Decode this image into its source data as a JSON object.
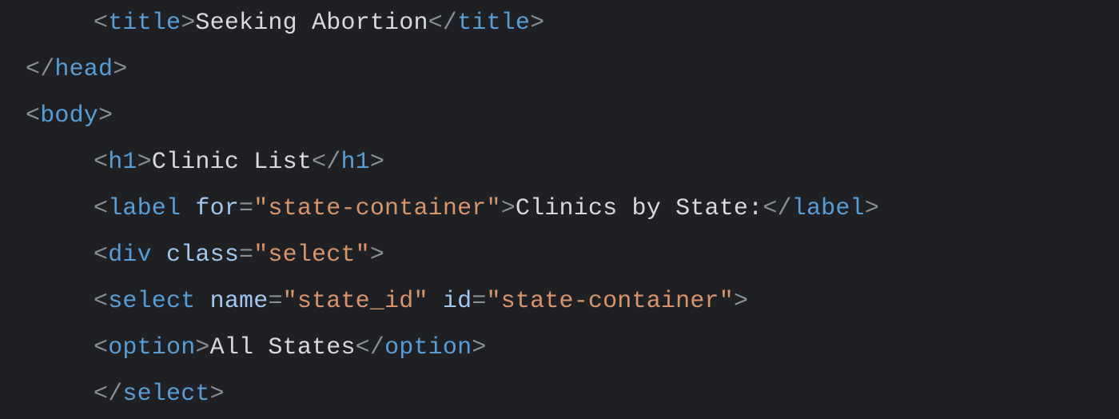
{
  "indent": {
    "one": "",
    "two": ""
  },
  "code": {
    "l1": {
      "tag": "title",
      "text": "Seeking Abortion"
    },
    "l2": {
      "tag": "head"
    },
    "l3": {
      "tag": "body"
    },
    "l4": {
      "tag": "h1",
      "text": "Clinic List"
    },
    "l5": {
      "tag": "label",
      "attr": "for",
      "val": "\"state-container\"",
      "text": "Clinics by State:"
    },
    "l6": {
      "tag": "div",
      "attr": "class",
      "val": "\"select\""
    },
    "l7": {
      "tag": "select",
      "attr1": "name",
      "val1": "\"state_id\"",
      "attr2": "id",
      "val2": "\"state-container\""
    },
    "l8": {
      "tag": "option",
      "text": "All States"
    },
    "l9": {
      "tag": "select"
    }
  }
}
